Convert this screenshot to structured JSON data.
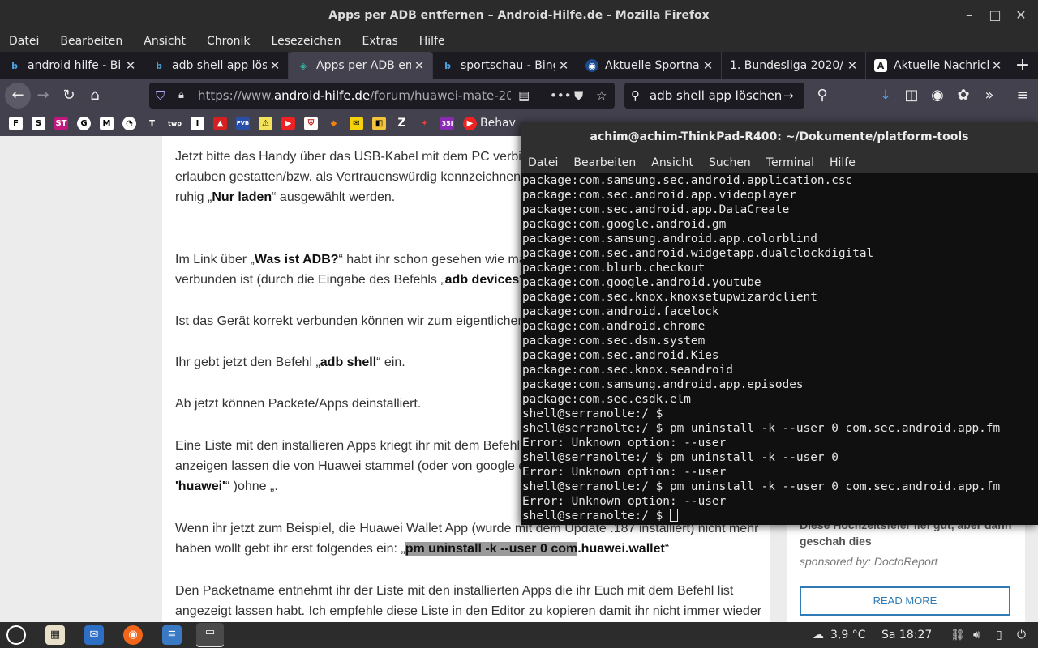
{
  "window": {
    "title": "Apps per ADB entfernen – Android-Hilfe.de - Mozilla Firefox",
    "minimize": "–",
    "maximize": "□",
    "close": "✕"
  },
  "menubar": [
    "Datei",
    "Bearbeiten",
    "Ansicht",
    "Chronik",
    "Lesezeichen",
    "Extras",
    "Hilfe"
  ],
  "tabs": [
    {
      "label": "android hilfe - Bing",
      "icon": "bing-icon",
      "active": false
    },
    {
      "label": "adb shell app löschen",
      "icon": "bing-icon",
      "active": false
    },
    {
      "label": "Apps per ADB entfernen",
      "icon": "android-hilfe-icon",
      "active": true
    },
    {
      "label": "sportschau - Bing",
      "icon": "bing-icon",
      "active": false
    },
    {
      "label": "Aktuelle Sportnachrichten",
      "icon": "globe-icon",
      "active": false
    },
    {
      "label": "1. Bundesliga 2020/21",
      "icon": "",
      "active": false
    },
    {
      "label": "Aktuelle Nachrichten",
      "icon": "news-icon",
      "active": false
    }
  ],
  "nav": {
    "url_prefix": "https://www.",
    "url_domain": "android-hilfe.de",
    "url_path": "/forum/huawei-mate-20-p",
    "search_value": "adb shell app löschen",
    "more": "•••"
  },
  "bookmarks": {
    "label_behav": "Behav"
  },
  "article": {
    "p1_a": "Jetzt bitte das Handy über das USB-Kabel mit dem PC verbin",
    "p1_b": "erlauben gestatten/bzw. als Vertrauenswürdig kennzeichnen",
    "p1_c1": "ruhig „",
    "p1_c2": "Nur laden",
    "p1_c3": "“ ausgewählt werden.",
    "p2_a1": "Im Link über „",
    "p2_a2": "Was ist ADB?",
    "p2_a3": "“ habt ihr schon gesehen wie man",
    "p2_b1": "verbunden ist (durch die Eingabe des Befehls „",
    "p2_b2": "adb devices",
    "p2_b3": "“)",
    "p3": "Ist das Gerät korrekt verbunden können wir zum eigentlichen",
    "p4_1": "Ihr gebt jetzt den Befehl „",
    "p4_2": "adb shell",
    "p4_3": "“ ein.",
    "p5": "Ab jetzt können Packete/Apps deinstalliert.",
    "p6_a": "Eine Liste mit den installieren Apps kriegt ihr mit dem Befehl",
    "p6_b": "anzeigen lassen die von Huawei stammel (oder von google e",
    "p6_c1": "'huawei'",
    "p6_c2": "“ )ohne „.",
    "p7_a": "Wenn ihr jetzt zum Beispiel, die Huawei Wallet App (wurde mit dem Update .187 installiert) nicht mehr",
    "p7_b1": "haben wollt gebt ihr erst folgendes ein: „",
    "p7_b2": "pm uninstall -k --user 0 com",
    "p7_b3": ".huawei.wallet",
    "p7_b4": "“",
    "p8_a": "Den Packetname entnehmt ihr der Liste mit den installierten Apps die ihr Euch mit dem Befehl list",
    "p8_b": "angezeigt lassen habt. Ich empfehle diese Liste in den Editor zu kopieren damit ihr nicht immer wieder"
  },
  "ad": {
    "title": "Diese Hochzeitsfeier lief gut, aber dann geschah dies",
    "sponsor": "sponsored by: DoctoReport",
    "button": "READ MORE"
  },
  "terminal": {
    "title": "achim@achim-ThinkPad-R400: ~/Dokumente/platform-tools",
    "menu": [
      "Datei",
      "Bearbeiten",
      "Ansicht",
      "Suchen",
      "Terminal",
      "Hilfe"
    ],
    "lines": [
      "package:com.samsung.sec.android.application.csc",
      "package:com.sec.android.app.videoplayer",
      "package:com.sec.android.app.DataCreate",
      "package:com.google.android.gm",
      "package:com.samsung.android.app.colorblind",
      "package:com.sec.android.widgetapp.dualclockdigital",
      "package:com.blurb.checkout",
      "package:com.google.android.youtube",
      "package:com.sec.knox.knoxsetupwizardclient",
      "package:com.android.facelock",
      "package:com.android.chrome",
      "package:com.sec.dsm.system",
      "package:com.sec.android.Kies",
      "package:com.sec.knox.seandroid",
      "package:com.samsung.android.app.episodes",
      "package:com.sec.esdk.elm",
      "shell@serranolte:/ $",
      "shell@serranolte:/ $ pm uninstall -k --user 0 com.sec.android.app.fm",
      "Error: Unknown option: --user",
      "shell@serranolte:/ $ pm uninstall -k --user 0",
      "Error: Unknown option: --user",
      "shell@serranolte:/ $ pm uninstall -k --user 0 com.sec.android.app.fm",
      "Error: Unknown option: --user"
    ],
    "prompt": "shell@serranolte:/ $ "
  },
  "panel": {
    "weather": "3,9 °C",
    "clock": "Sa 18:27"
  }
}
